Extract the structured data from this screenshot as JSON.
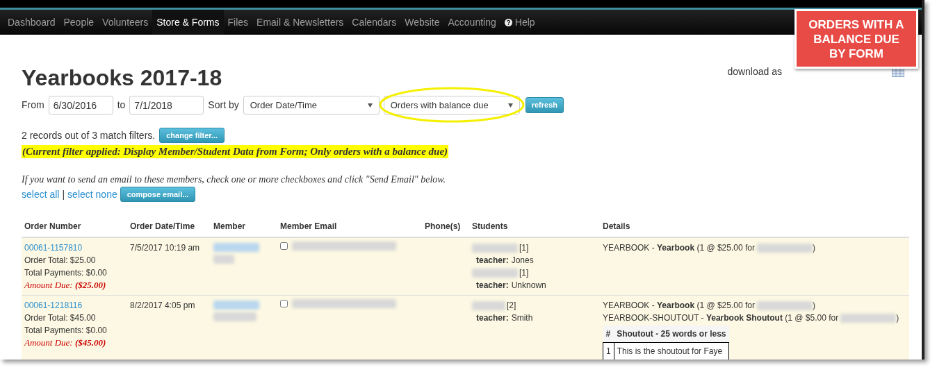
{
  "nav": [
    {
      "label": "Dashboard",
      "selected": false,
      "kind": "link"
    },
    {
      "label": "People",
      "selected": false,
      "kind": "link"
    },
    {
      "label": "Volunteers",
      "selected": false,
      "kind": "link"
    },
    {
      "label": "Store & Forms",
      "selected": true,
      "kind": "link"
    },
    {
      "label": "Files",
      "selected": false,
      "kind": "link"
    },
    {
      "label": "Email & Newsletters",
      "selected": false,
      "kind": "link"
    },
    {
      "label": "Calendars",
      "selected": false,
      "kind": "link"
    },
    {
      "label": "Website",
      "selected": false,
      "kind": "link"
    },
    {
      "label": "Accounting",
      "selected": false,
      "kind": "link"
    },
    {
      "label": "Help",
      "selected": false,
      "kind": "help"
    }
  ],
  "callout": "ORDERS WITH A BALANCE DUE BY FORM",
  "title": "Yearbooks 2017-18",
  "download_label": "download as",
  "filters": {
    "from_label": "From",
    "from": "6/30/2016",
    "to_label": "to",
    "to": "7/1/2018",
    "sort_label": "Sort by",
    "sort": "Order Date/Time",
    "filter": "Orders with balance due",
    "refresh": "refresh"
  },
  "match_text": "2 records out of 3 match filters.",
  "change_filter": "change filter...",
  "filter_note": "(Current filter applied: Display Member/Student Data from Form; Only orders with a balance due)",
  "email_hint": "If you want to send an email to these members, check one or more checkboxes and click \"Send Email\" below.",
  "select_all": "select all",
  "separator": "|",
  "select_none": "select none",
  "compose": "compose email...",
  "columns": [
    "Order Number",
    "Order Date/Time",
    "Member",
    "Member Email",
    "Phone(s)",
    "Students",
    "Details"
  ],
  "rows": [
    {
      "order_number": "00061-1157810",
      "order_total": "Order Total: $25.00",
      "total_payments": "Total Payments: $0.00",
      "amount_due_label": "Amount Due:",
      "amount_due": "($25.00)",
      "date": "7/5/2017 10:19 am",
      "checked": false,
      "students": [
        {
          "count": "[1]",
          "teacher_label": "teacher:",
          "teacher": "Jones"
        },
        {
          "count": "[1]",
          "teacher_label": "teacher:",
          "teacher": "Unknown"
        }
      ],
      "details": [
        {
          "text": "YEARBOOK - **Yearbook** (1 @ $25.00 for",
          "close": ")"
        }
      ]
    },
    {
      "order_number": "00061-1218116",
      "order_total": "Order Total: $45.00",
      "total_payments": "Total Payments: $0.00",
      "amount_due_label": "Amount Due:",
      "amount_due": "($45.00)",
      "date": "8/2/2017 4:05 pm",
      "checked": false,
      "students": [
        {
          "count": "[2]",
          "teacher_label": "teacher:",
          "teacher": "Smith"
        }
      ],
      "details": [
        {
          "text": "YEARBOOK - **Yearbook** (1 @ $25.00 for",
          "close": ")"
        },
        {
          "text": "YEARBOOK-SHOUTOUT - **Yearbook Shoutout** (1 @ $5.00 for",
          "close": ")"
        }
      ],
      "shoutouts": {
        "columns": [
          "#",
          "Shoutout - 25 words or less"
        ],
        "rows": [
          [
            "1",
            "This is the shoutout for Faye"
          ]
        ]
      }
    }
  ]
}
